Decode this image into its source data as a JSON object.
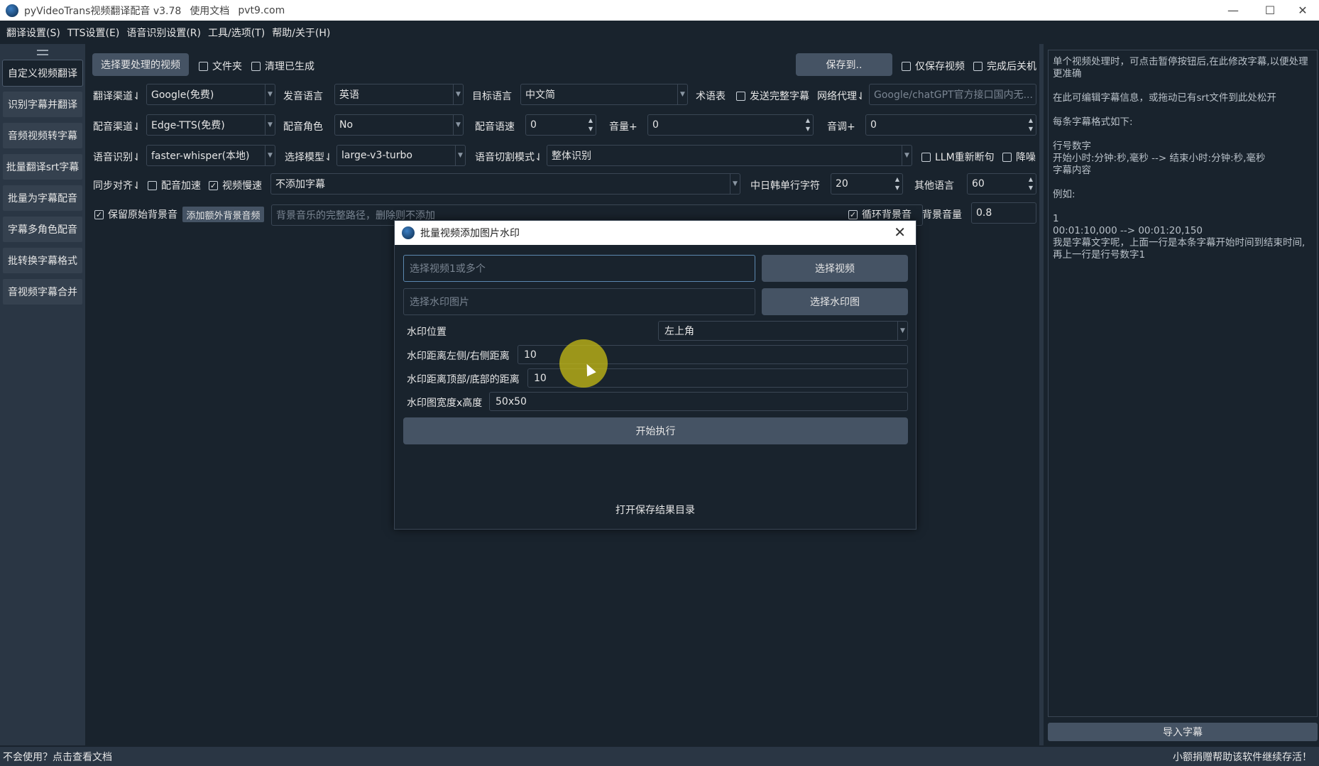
{
  "window": {
    "title": "pyVideoTrans视频翻译配音 v3.78",
    "link1": "使用文档",
    "link2": "pvt9.com",
    "minimize": "—",
    "maximize": "☐",
    "close": "✕"
  },
  "menu": [
    "翻译设置(S)",
    "TTS设置(E)",
    "语音识别设置(R)",
    "工具/选项(T)",
    "帮助/关于(H)"
  ],
  "sidebar": {
    "items": [
      "自定义视频翻译",
      "识别字幕并翻译",
      "音频视频转字幕",
      "批量翻译srt字幕",
      "批量为字幕配音",
      "字幕多角色配音",
      "批转换字幕格式",
      "音视频字幕合并"
    ]
  },
  "toolbar": {
    "select_video": "选择要处理的视频",
    "folder": "文件夹",
    "clear_generated": "清理已生成",
    "save_to": "保存到..",
    "only_save_video": "仅保存视频",
    "shutdown_after": "完成后关机"
  },
  "row1": {
    "trans_channel_label": "翻译渠道⇃",
    "trans_channel": "Google(免费)",
    "source_lang_label": "发音语言",
    "source_lang": "英语",
    "target_lang_label": "目标语言",
    "target_lang": "中文简",
    "glossary": "术语表",
    "send_full": "发送完整字幕",
    "proxy_label": "网络代理⇃",
    "proxy_placeholder": "Google/chatGPT官方接口国内无..."
  },
  "row2": {
    "tts_label": "配音渠道⇃",
    "tts": "Edge-TTS(免费)",
    "role_label": "配音角色",
    "role": "No",
    "rate_label": "配音语速",
    "rate": "0",
    "volume_label": "音量+",
    "volume": "0",
    "pitch_label": "音调+",
    "pitch": "0"
  },
  "row3": {
    "asr_label": "语音识别⇃",
    "asr": "faster-whisper(本地)",
    "model_label": "选择模型⇃",
    "model": "large-v3-turbo",
    "split_label": "语音切割模式⇃",
    "split": "整体识别",
    "llm_resplit": "LLM重新断句",
    "denoise": "降噪"
  },
  "row4": {
    "sync_label": "同步对齐⇃",
    "tts_speedup": "配音加速",
    "video_slow": "视频慢速",
    "subtitle_mode": "不添加字幕",
    "cjk_chars_label": "中日韩单行字符",
    "cjk_chars": "20",
    "other_lang_label": "其他语言",
    "other_lang": "60"
  },
  "row5": {
    "keep_bg": "保留原始背景音",
    "add_bg_btn": "添加额外背景音频",
    "bg_path_placeholder": "背景音乐的完整路径，删除则不添加",
    "loop_bg": "循环背景音",
    "bg_volume_label": "背景音量",
    "bg_volume": "0.8"
  },
  "right_panel": {
    "p1": "单个视频处理时，可点击暂停按钮后,在此修改字幕,以便处理更准确",
    "p2": "在此可编辑字幕信息，或拖动已有srt文件到此处松开",
    "p3": "每条字幕格式如下:",
    "p4": "行号数字\n开始小时:分钟:秒,毫秒 --> 结束小时:分钟:秒,毫秒\n字幕内容",
    "p5": "例如:",
    "p6": "1\n00:01:10,000 --> 00:01:20,150\n我是字幕文字呢，上面一行是本条字幕开始时间到结束时间,再上一行是行号数字1",
    "import_btn": "导入字幕"
  },
  "status": {
    "left": "不会使用？点击查看文档",
    "right": "小额捐赠帮助该软件继续存活！"
  },
  "dialog": {
    "title": "批量视频添加图片水印",
    "close": "✕",
    "video_placeholder": "选择视频1或多个",
    "select_video_btn": "选择视频",
    "image_placeholder": "选择水印图片",
    "select_image_btn": "选择水印图",
    "position_label": "水印位置",
    "position": "左上角",
    "lr_label": "水印距离左侧/右侧距离",
    "lr_value": "10",
    "tb_label": "水印距离顶部/底部的距离",
    "tb_value": "10",
    "size_label": "水印图宽度x高度",
    "size_value": "50x50",
    "start_btn": "开始执行",
    "open_dir": "打开保存结果目录"
  },
  "colors": {
    "bg": "#19232d",
    "button": "#455364",
    "sidebar": "#2a3644",
    "cursor_highlight": "#c8be14"
  }
}
